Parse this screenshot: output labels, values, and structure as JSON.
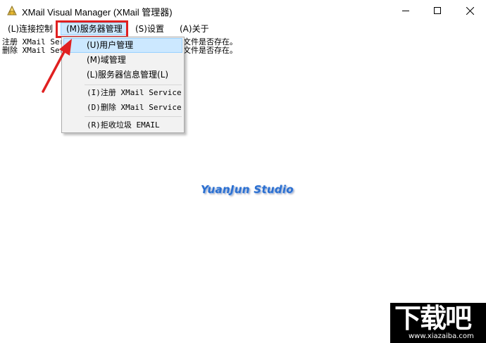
{
  "window": {
    "title": "XMail Visual Manager (XMail 管理器)",
    "controls": [
      "minimize",
      "maximize",
      "close"
    ]
  },
  "menubar": {
    "items": [
      {
        "label": "(L)连接控制"
      },
      {
        "label": "(M)服务器管理"
      },
      {
        "label": "(S)设置"
      },
      {
        "label": "(A)关于"
      }
    ]
  },
  "content": {
    "lines": [
      {
        "left": "注册 XMail Ser",
        "right": "文件是否存在。"
      },
      {
        "left": "删除 XMail Ser",
        "right": "文件是否存在。"
      }
    ]
  },
  "dropdown": {
    "items": [
      {
        "label": "(U)用户管理",
        "selected": true
      },
      {
        "label": "(M)域管理"
      },
      {
        "label": "(L)服务器信息管理(L)"
      },
      {
        "label": "(I)注册 XMail Service"
      },
      {
        "label": "(D)删除 XMail Service"
      },
      {
        "label": "(R)拒收垃圾 EMAIL"
      }
    ]
  },
  "watermark": {
    "text": "YuanJun Studio"
  },
  "logo": {
    "main": "下载吧",
    "sub": "www.xiazaiba.com"
  },
  "colors": {
    "menu_highlight": "#cce8ff",
    "annotation_red": "#e02020",
    "watermark_blue": "#2b6fd0"
  }
}
